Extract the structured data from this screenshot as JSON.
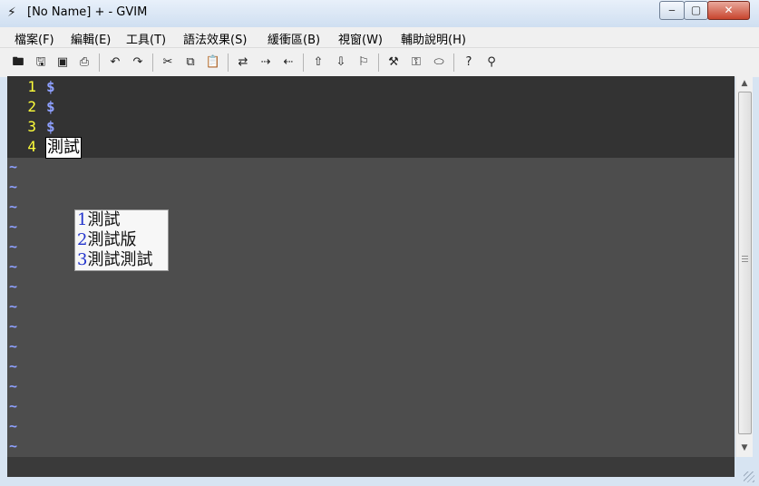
{
  "window": {
    "title": "[No Name] + - GVIM",
    "app_icon": "vim-icon",
    "controls": {
      "minimize": "‒",
      "maximize": "▢",
      "close": "✕"
    }
  },
  "menubar": {
    "items": [
      {
        "label": "檔案(F)"
      },
      {
        "label": "編輯(E)"
      },
      {
        "label": "工具(T)"
      },
      {
        "label": "語法效果(S)"
      },
      {
        "label": "緩衝區(B)"
      },
      {
        "label": "視窗(W)"
      },
      {
        "label": "輔助說明(H)"
      }
    ]
  },
  "toolbar": {
    "buttons": [
      {
        "name": "open-icon",
        "glyph": "🖿"
      },
      {
        "name": "save-icon",
        "glyph": "🖫"
      },
      {
        "name": "save-all-icon",
        "glyph": "▣"
      },
      {
        "name": "print-icon",
        "glyph": "⎙"
      },
      {
        "name": "undo-icon",
        "glyph": "↶"
      },
      {
        "name": "redo-icon",
        "glyph": "↷"
      },
      {
        "name": "cut-icon",
        "glyph": "✂"
      },
      {
        "name": "copy-icon",
        "glyph": "⧉"
      },
      {
        "name": "paste-icon",
        "glyph": "📋"
      },
      {
        "name": "replace-icon",
        "glyph": "⇄"
      },
      {
        "name": "find-next-icon",
        "glyph": "⇢"
      },
      {
        "name": "find-prev-icon",
        "glyph": "⇠"
      },
      {
        "name": "load-session-icon",
        "glyph": "⇧"
      },
      {
        "name": "save-session-icon",
        "glyph": "⇩"
      },
      {
        "name": "run-script-icon",
        "glyph": "⚐"
      },
      {
        "name": "make-icon",
        "glyph": "⚒"
      },
      {
        "name": "ctags-icon",
        "glyph": "⚿"
      },
      {
        "name": "jump-tag-icon",
        "glyph": "⬭"
      },
      {
        "name": "help-icon",
        "glyph": "?"
      },
      {
        "name": "find-help-icon",
        "glyph": "⚲"
      }
    ]
  },
  "editor": {
    "lines": [
      {
        "number": "1",
        "text": "$"
      },
      {
        "number": "2",
        "text": "$"
      },
      {
        "number": "3",
        "text": "$"
      },
      {
        "number": "4",
        "text": "測試"
      }
    ],
    "tilde": "~",
    "tilde_count": 15,
    "colors": {
      "background": "#4d4d4d",
      "line_number": "#ffff3a",
      "nontext": "#8ea0ff"
    }
  },
  "popup": {
    "items": [
      {
        "num": "1",
        "text": "測試"
      },
      {
        "num": "2",
        "text": "測試版"
      },
      {
        "num": "3",
        "text": "測試測試"
      }
    ]
  }
}
